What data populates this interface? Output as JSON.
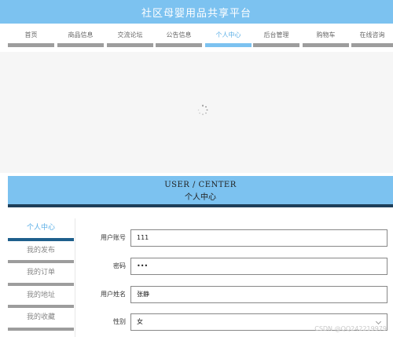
{
  "header": {
    "title": "社区母婴用品共享平台"
  },
  "nav": {
    "items": [
      {
        "label": "首页"
      },
      {
        "label": "商品信息"
      },
      {
        "label": "交流论坛"
      },
      {
        "label": "公告信息"
      },
      {
        "label": "个人中心"
      },
      {
        "label": "后台管理"
      },
      {
        "label": "购物车"
      },
      {
        "label": "在线咨询"
      }
    ],
    "active": "个人中心"
  },
  "section": {
    "title_en": "USER / CENTER",
    "title_cn": "个人中心"
  },
  "sidebar": {
    "items": [
      {
        "label": "个人中心"
      },
      {
        "label": "我的发布"
      },
      {
        "label": "我的订单"
      },
      {
        "label": "我的地址"
      },
      {
        "label": "我的收藏"
      }
    ],
    "active": "个人中心"
  },
  "form": {
    "account": {
      "label": "用户账号",
      "value": "111"
    },
    "password": {
      "label": "密码",
      "value": "•••"
    },
    "name": {
      "label": "用户姓名",
      "value": "张静"
    },
    "gender": {
      "label": "性别",
      "value": "女"
    }
  },
  "watermark": "CSDN @QQ242219979",
  "colors": {
    "accent": "#7cc2f0",
    "dark_accent": "#1e3f5a",
    "tab_bar": "#9d9d9d"
  }
}
